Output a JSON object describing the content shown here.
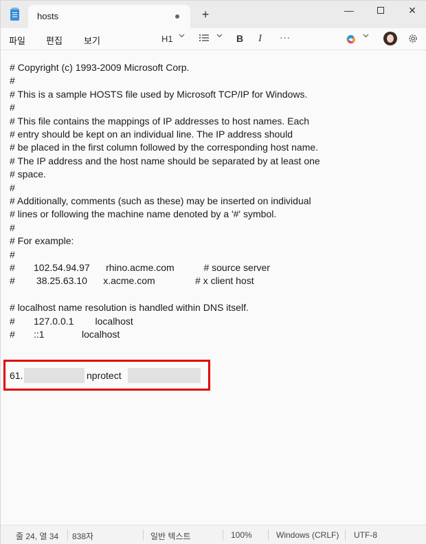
{
  "window": {
    "tab_title": "hosts",
    "new_tab": "+",
    "minimize": "—",
    "close": "✕"
  },
  "menu": {
    "file": "파일",
    "edit": "편집",
    "view": "보기"
  },
  "toolbar": {
    "heading": "H1",
    "bold": "B",
    "italic": "I",
    "more": "···"
  },
  "editor": {
    "lines": [
      "# Copyright (c) 1993-2009 Microsoft Corp.",
      "#",
      "# This is a sample HOSTS file used by Microsoft TCP/IP for Windows.",
      "#",
      "# This file contains the mappings of IP addresses to host names. Each",
      "# entry should be kept on an individual line. The IP address should",
      "# be placed in the first column followed by the corresponding host name.",
      "# The IP address and the host name should be separated by at least one",
      "# space.",
      "#",
      "# Additionally, comments (such as these) may be inserted on individual",
      "# lines or following the machine name denoted by a '#' symbol.",
      "#",
      "# For example:",
      "#",
      "#       102.54.94.97      rhino.acme.com           # source server",
      "#        38.25.63.10      x.acme.com               # x client host",
      "",
      "# localhost name resolution is handled within DNS itself.",
      "#       127.0.0.1        localhost",
      "#       ::1              localhost"
    ],
    "last_line_prefix": "61.",
    "last_line_host": "nprotect"
  },
  "status": {
    "position": "줄 24, 열 34",
    "chars": "838자",
    "mode": "일반 텍스트",
    "zoom": "100%",
    "line_ending": "Windows (CRLF)",
    "encoding": "UTF-8"
  },
  "colors": {
    "highlight": "#e00000",
    "accent": "#3b8ed8"
  }
}
